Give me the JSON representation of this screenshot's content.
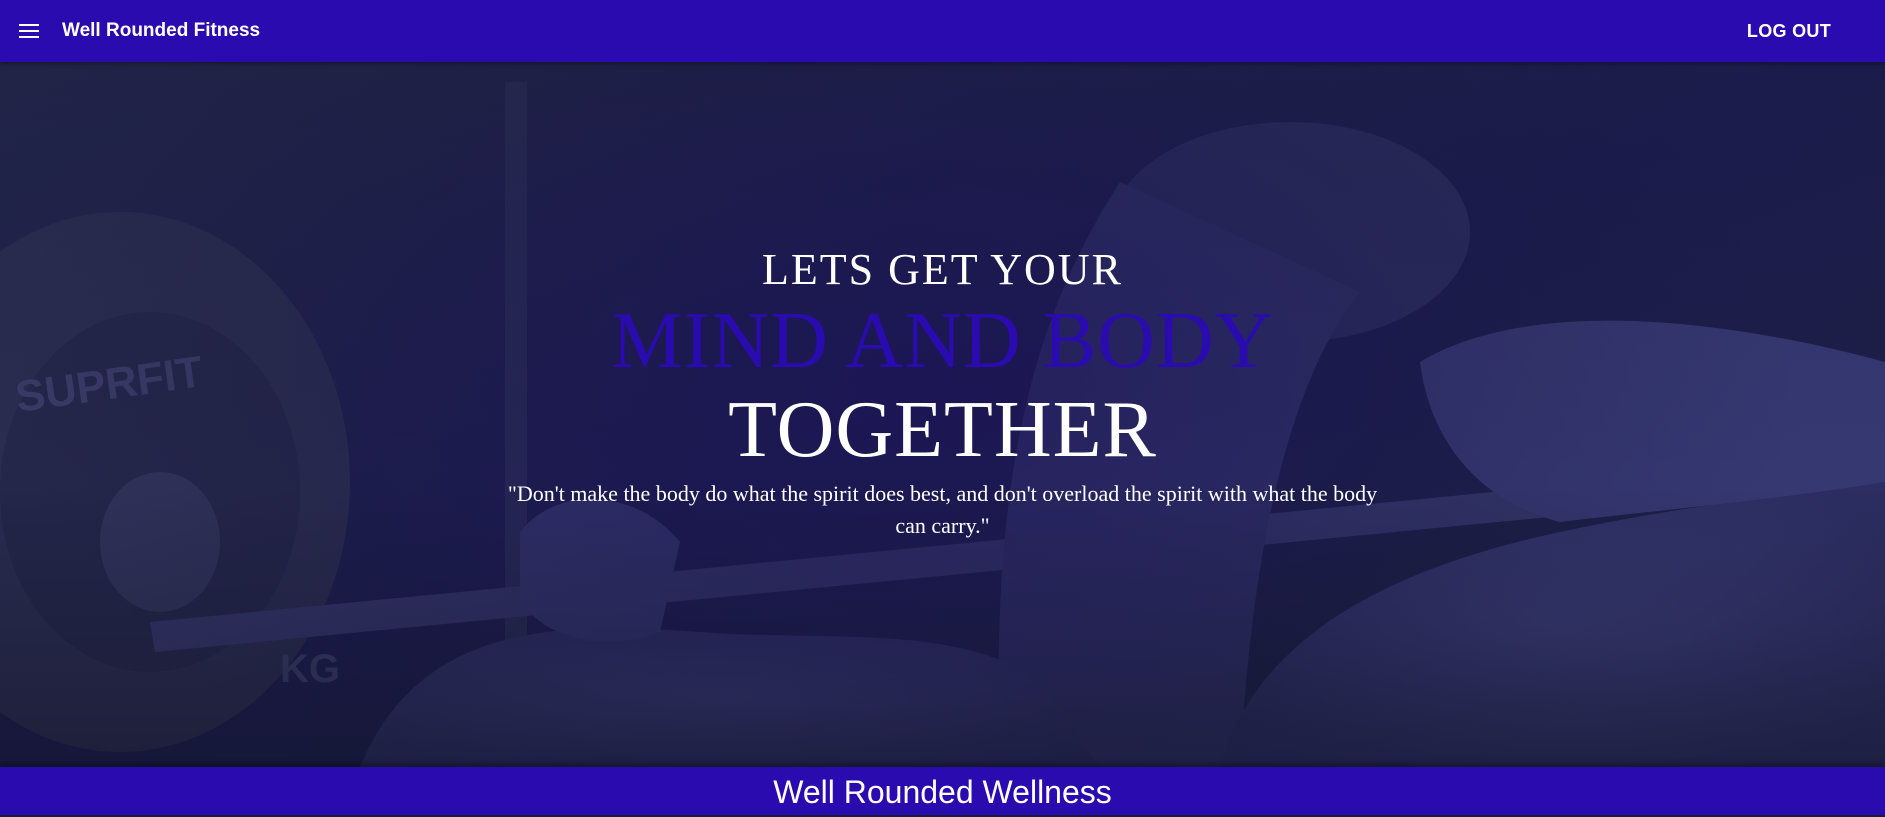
{
  "app_bar": {
    "menu_icon": "menu-icon",
    "title": "Well Rounded Fitness",
    "logout_label": "LOG OUT",
    "background": "#2a0bb0"
  },
  "hero": {
    "line1": "LETS GET YOUR",
    "line2": "MIND AND BODY",
    "line3": "TOGETHER",
    "quote": "\"Don't make the body do what the spirit does best, and don't overload the spirit with what the body can carry.\"",
    "accent_color": "#2a0bb0",
    "image": "woman-lifting-barbell-photo"
  },
  "footer": {
    "title": "Well Rounded Wellness"
  }
}
